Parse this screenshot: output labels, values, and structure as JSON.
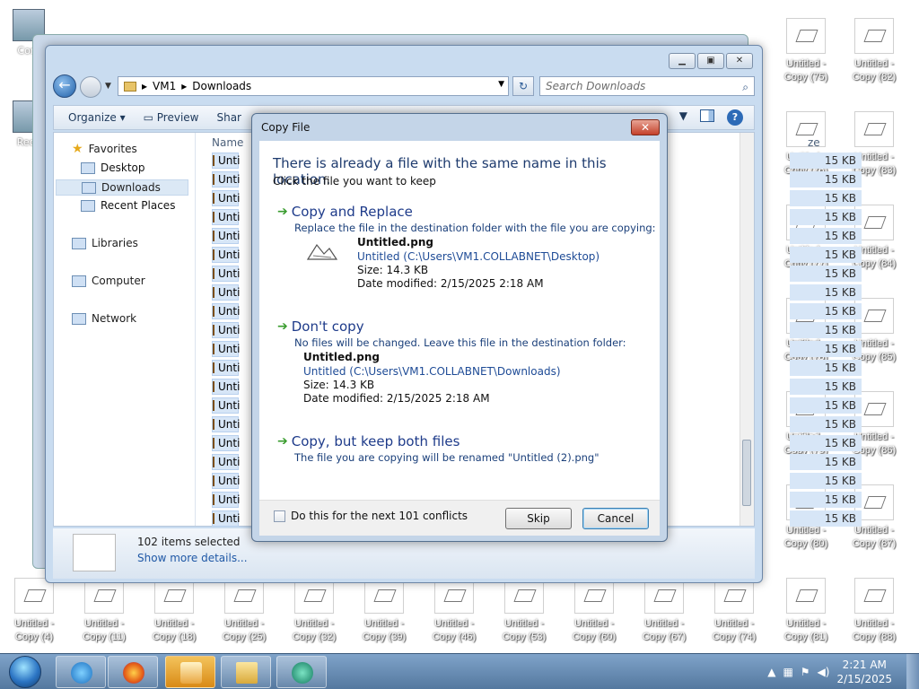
{
  "desktop": {
    "system_icons": [
      {
        "label": "Com"
      },
      {
        "label": "Recy"
      }
    ],
    "right_col1": [
      "Untitled - Copy (75)",
      "Untitled - Copy (76)",
      "Untitled - Copy (77)",
      "Untitled - Copy (78)",
      "Untitled - Copy (79)",
      "Untitled - Copy (80)",
      "Untitled - Copy (81)"
    ],
    "right_col2": [
      "Untitled - Copy (82)",
      "Untitled - Copy (83)",
      "Untitled - Copy (84)",
      "Untitled - Copy (85)",
      "Untitled - Copy (86)",
      "Untitled - Copy (87)",
      "Untitled - Copy (88)"
    ],
    "bottom_row": [
      "Untitled - Copy (4)",
      "Untitled - Copy (11)",
      "Untitled - Copy (18)",
      "Untitled - Copy (25)",
      "Untitled - Copy (32)",
      "Untitled - Copy (39)",
      "Untitled - Copy (46)",
      "Untitled - Copy (53)",
      "Untitled - Copy (60)",
      "Untitled - Copy (67)",
      "Untitled - Copy (74)"
    ],
    "left_partial": [
      "Untit",
      "Untit",
      "Untit",
      "Untit",
      "Untit"
    ]
  },
  "explorer": {
    "address": [
      "VM1",
      "Downloads"
    ],
    "search_placeholder": "Search Downloads",
    "toolbar": {
      "organize": "Organize ▾",
      "preview": "Preview",
      "share": "Shar"
    },
    "nav": {
      "favorites": "Favorites",
      "desktop": "Desktop",
      "downloads": "Downloads",
      "recent": "Recent Places",
      "libraries": "Libraries",
      "computer": "Computer",
      "network": "Network"
    },
    "columns": {
      "name": "Name",
      "size": "ze"
    },
    "file_label": "Unti",
    "file_size": "15 KB",
    "details": {
      "count": "102 items selected",
      "more": "Show more details..."
    }
  },
  "dialog": {
    "title": "Copy File",
    "heading": "There is already a file with the same name in this location.",
    "subheading": "Click the file you want to keep",
    "replace": {
      "title": "Copy and Replace",
      "desc": "Replace the file in the destination folder with the file you are copying:",
      "file": "Untitled.png",
      "path": "Untitled (C:\\Users\\VM1.COLLABNET\\Desktop)",
      "size": "Size: 14.3 KB",
      "date": "Date modified: 2/15/2025 2:18 AM"
    },
    "dontcopy": {
      "title": "Don't copy",
      "desc": "No files will be changed. Leave this file in the destination folder:",
      "file": "Untitled.png",
      "path": "Untitled (C:\\Users\\VM1.COLLABNET\\Downloads)",
      "size": "Size: 14.3 KB",
      "date": "Date modified: 2/15/2025 2:18 AM"
    },
    "keepboth": {
      "title": "Copy, but keep both files",
      "desc": "The file you are copying will be renamed \"Untitled (2).png\""
    },
    "checkbox": "Do this for the next 101 conflicts",
    "skip": "Skip",
    "cancel": "Cancel"
  },
  "taskbar": {
    "time": "2:21 AM",
    "date": "2/15/2025"
  },
  "colors": {
    "accent": "#1e3b8a",
    "link": "#1e4b96",
    "arrow": "#3a9c2f"
  }
}
